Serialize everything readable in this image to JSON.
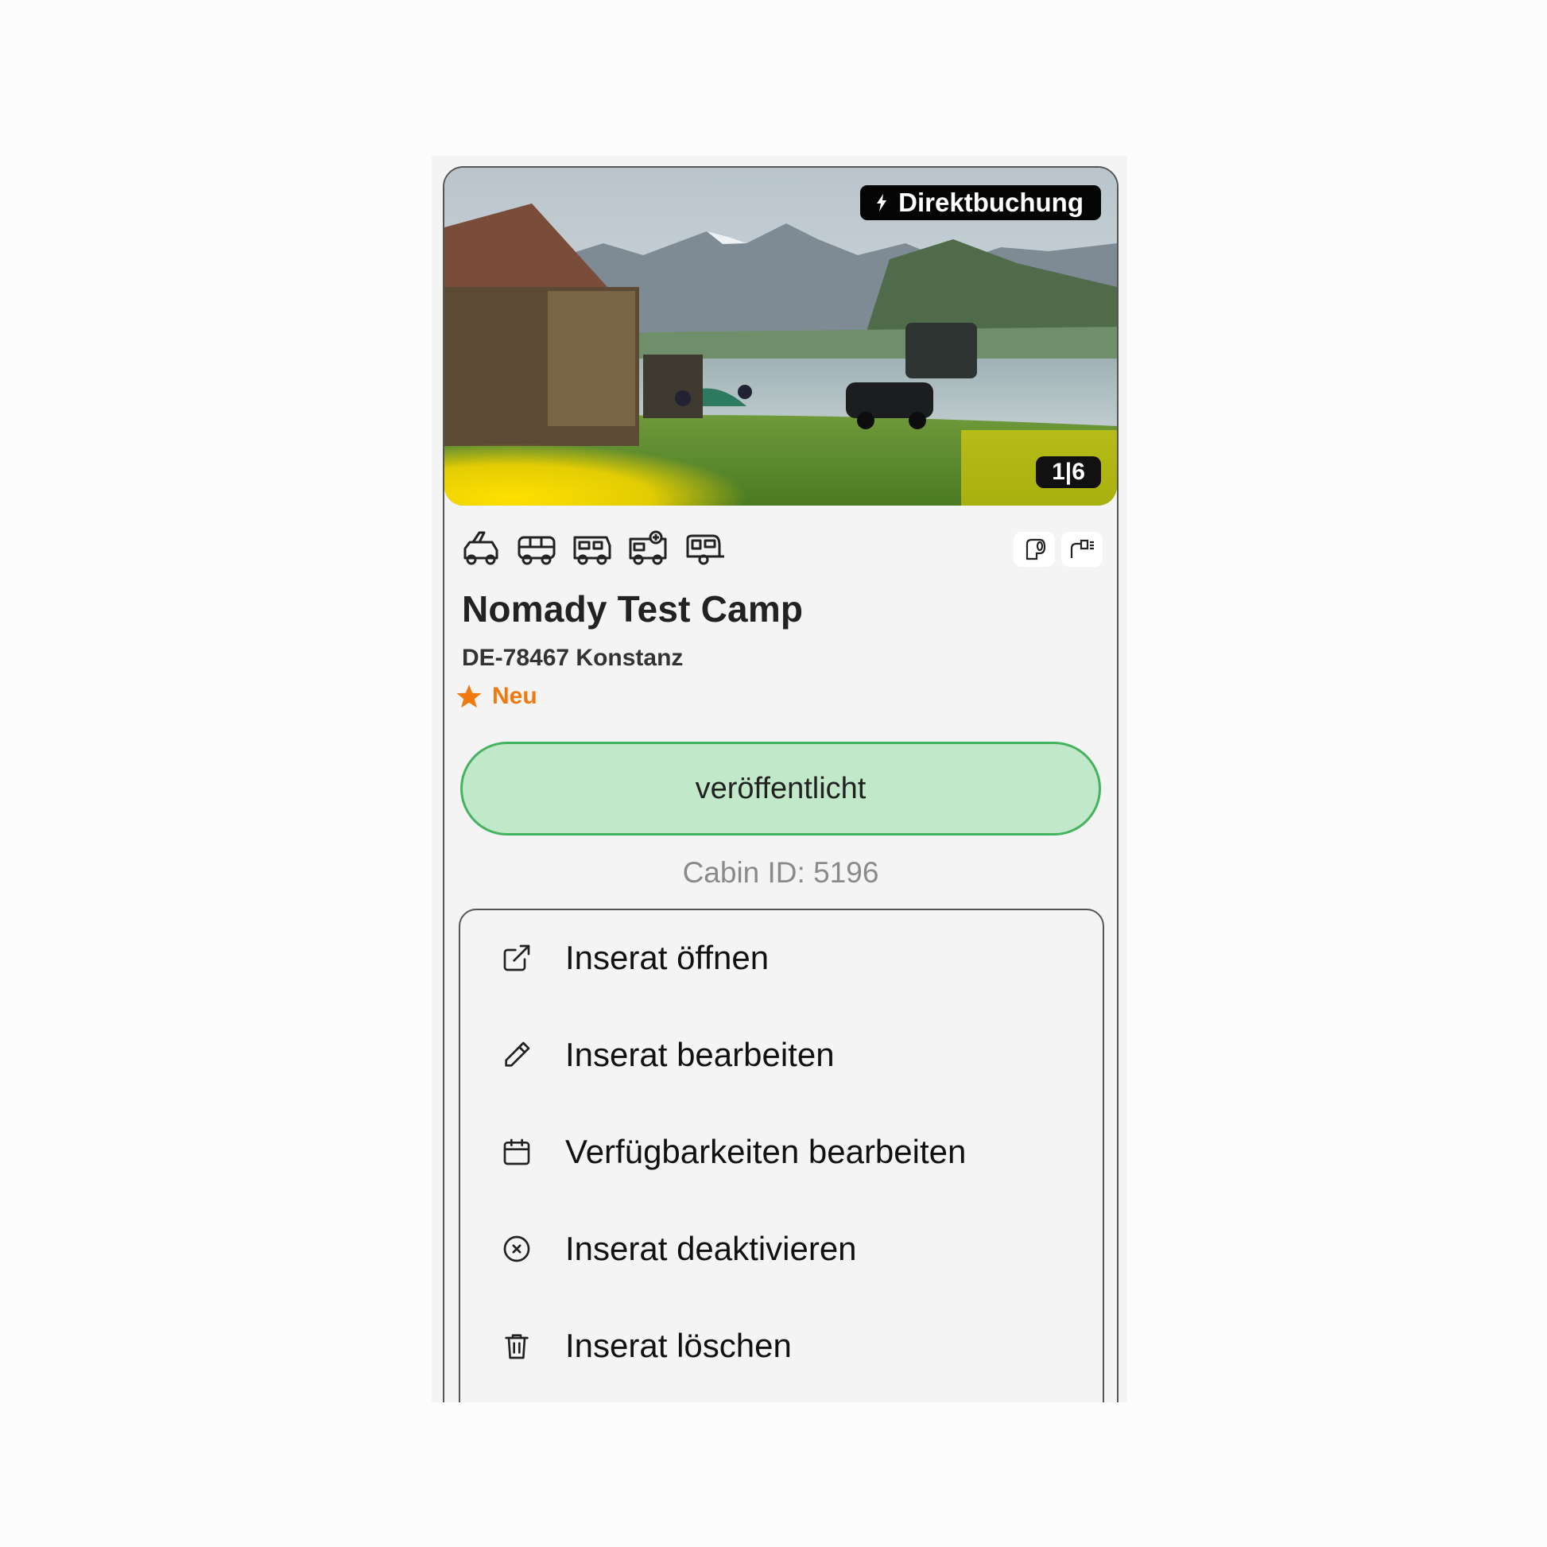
{
  "listing": {
    "badge_direct": "Direktbuchung",
    "photo_counter": "1|6",
    "title": "Nomady Test Camp",
    "address": "DE-78467 Konstanz",
    "rating_label": "Neu",
    "status_label": "veröffentlicht",
    "cabin_id": "Cabin ID: 5196",
    "vehicle_icons": [
      "rooftop-tent-car-icon",
      "van-icon",
      "camper-van-icon",
      "motorhome-icon",
      "caravan-icon"
    ],
    "amenity_icons": [
      "toilet-paper-icon",
      "shower-icon"
    ]
  },
  "menu": {
    "items": [
      {
        "label": "Inserat öffnen",
        "icon": "external-link-icon"
      },
      {
        "label": "Inserat bearbeiten",
        "icon": "pencil-icon"
      },
      {
        "label": "Verfügbarkeiten bearbeiten",
        "icon": "calendar-icon"
      },
      {
        "label": "Inserat deaktivieren",
        "icon": "x-circle-icon"
      },
      {
        "label": "Inserat löschen",
        "icon": "trash-icon"
      }
    ]
  },
  "colors": {
    "status_bg": "#c1e8c9",
    "status_border": "#44b35e",
    "rating": "#f07a10"
  }
}
